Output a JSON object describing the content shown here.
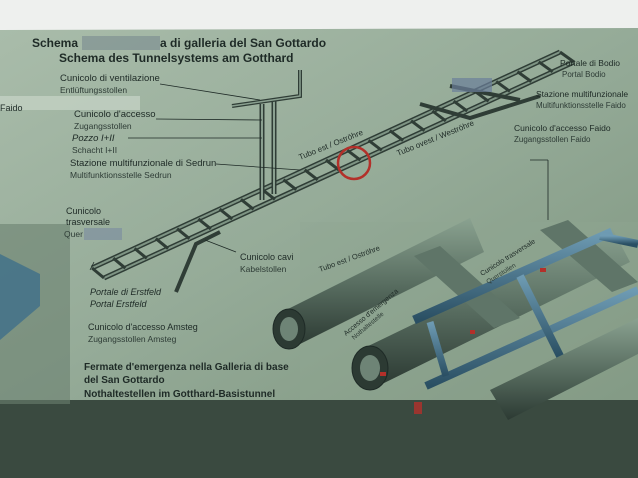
{
  "header": {
    "title_it_prefix": "Schema",
    "title_it_suffix": "a di galleria del San Gottardo",
    "title_de": "Schema des Tunnelsystems am Gotthard"
  },
  "labels": {
    "ventilazione_it": "Cunicolo di ventilazione",
    "ventilazione_de": "Entlüftungsstollen",
    "faido_left": "Faido",
    "accesso_it": "Cunicolo d'accesso",
    "accesso_de": "Zugangsstollen",
    "pozzo_it": "Pozzo I+II",
    "pozzo_de": "Schacht I+II",
    "sedrun_it": "Stazione multifunzionale di Sedrun",
    "sedrun_de": "Multifunktionsstelle Sedrun",
    "trasversale_it_1": "Cunicolo",
    "trasversale_it_2": "trasversale",
    "trasversale_de": "Quer",
    "cavi_it": "Cunicolo cavi",
    "cavi_de": "Kabelstollen",
    "ersfeld_it": "Portale di Erstfeld",
    "ersfeld_de": "Portal Erstfeld",
    "amsteg_it": "Cunicolo d'accesso Amsteg",
    "amsteg_de": "Zugangsstollen Amsteg",
    "bodio_it": "Portale di Bodio",
    "bodio_de": "Portal Bodio",
    "faido_multi_it": "Stazione multifunzionale",
    "faido_multi_de": "Multifunktionsstelle Faido",
    "faido_access_it": "Cunicolo d'accesso Faido",
    "faido_access_de": "Zugangsstollen Faido",
    "tube_west": "Tubo est / Oströhre",
    "tube_east": "Tubo ovest / Weströhre",
    "tube_est_lower": "Tubo est / Oströhre",
    "emergency_it": "Accesso d'emergenza",
    "emergency_de": "Nothaltestelle",
    "cross_it": "Cunicolo trasversale",
    "cross_de": "Querstollen",
    "fermate_it_1": "Fermate d'emergenza nella Galleria di base",
    "fermate_it_2": "del San Gottardo",
    "fermate_de": "Nothaltestellen im Gotthard-Basistunnel"
  },
  "colors": {
    "paper_top": "#9fb4a2",
    "paper_lower": "#8fa593",
    "ink": "#1e2a26",
    "tube_dark": "#2f3d36",
    "tube_mid": "#5c7266",
    "pipe_blue": "#3f6f8a",
    "highlight_red": "#b3302a"
  }
}
